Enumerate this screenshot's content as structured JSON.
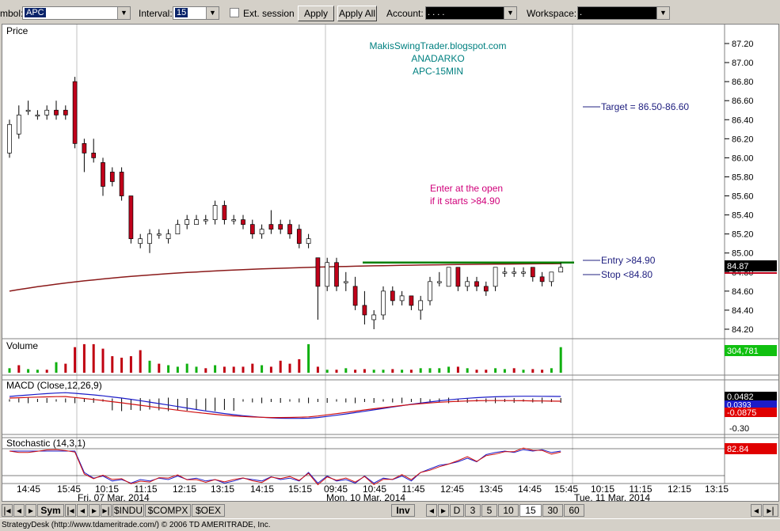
{
  "toolbar": {
    "symbol_label": "mbol:",
    "symbol_value": "APC",
    "interval_label": "Interval:",
    "interval_value": "15",
    "ext_session_label": "Ext. session",
    "apply_label": "Apply",
    "apply_all_label": "Apply All",
    "account_label": "Account:",
    "account_value": ".  .  .  .",
    "workspace_label": "Workspace:",
    "workspace_value": "."
  },
  "chart": {
    "price_panel_title": "Price",
    "watermark_line1": "MakisSwingTrader.blogspot.com",
    "watermark_line2": "ANADARKO",
    "watermark_line3": "APC-15MIN",
    "note_line1": "Enter at the open",
    "note_line2": "if it starts >84.90",
    "target_label": "Target = 86.50-86.60",
    "entry_label": "Entry >84.90",
    "stop_label": "Stop <84.80",
    "current_price_badge": "84.87",
    "price_axis_labels": [
      "87.20",
      "87.00",
      "86.80",
      "86.60",
      "86.40",
      "86.20",
      "86.00",
      "85.80",
      "85.60",
      "85.40",
      "85.20",
      "85.00",
      "84.80",
      "84.60",
      "84.40",
      "84.20"
    ],
    "volume_title": "Volume",
    "volume_badge": "304,781",
    "macd_title": "MACD (Close,12,26,9)",
    "macd_badge_1": "0.0482",
    "macd_badge_2": "0.0393",
    "macd_badge_3": "-0.0875",
    "macd_axis_low": "-0.30",
    "stoch_title": "Stochastic (14,3,1)",
    "stoch_badge": "82.84",
    "time_labels": [
      "14:45",
      "15:45",
      "10:15",
      "11:15",
      "12:15",
      "13:15",
      "14:15",
      "15:15",
      "09:45",
      "10:45",
      "11:45",
      "12:45",
      "13:45",
      "14:45",
      "15:45",
      "10:15",
      "11:15",
      "12:15",
      "13:15"
    ],
    "date_labels": [
      "Fri, 07 Mar, 2014",
      "Mon, 10 Mar, 2014",
      "Tue, 11 Mar, 2014"
    ],
    "colors": {
      "up": "#ffffff",
      "down": "#c0001a",
      "ma": "#8b1a1a",
      "entry_line": "#008000",
      "macd_line": "#1c1cc8",
      "signal_line": "#d01010",
      "watermark": "#008080",
      "note": "#d0007a",
      "label_blue": "#202080"
    }
  },
  "candles": [
    [
      86.05,
      86.35,
      86.0,
      86.4
    ],
    [
      86.25,
      86.45,
      86.2,
      86.55
    ],
    [
      86.5,
      86.5,
      86.45,
      86.6
    ],
    [
      86.45,
      86.45,
      86.4,
      86.5
    ],
    [
      86.45,
      86.5,
      86.4,
      86.55
    ],
    [
      86.5,
      86.45,
      86.4,
      86.6
    ],
    [
      86.5,
      86.45,
      86.4,
      86.55
    ],
    [
      86.8,
      86.15,
      86.1,
      86.85
    ],
    [
      86.15,
      86.05,
      85.85,
      86.2
    ],
    [
      86.05,
      86.0,
      85.95,
      86.2
    ],
    [
      85.95,
      85.7,
      85.6,
      86.0
    ],
    [
      85.85,
      85.75,
      85.7,
      85.9
    ],
    [
      85.85,
      85.6,
      85.55,
      85.9
    ],
    [
      85.6,
      85.15,
      85.1,
      85.6
    ],
    [
      85.1,
      85.15,
      85.05,
      85.2
    ],
    [
      85.1,
      85.2,
      85.0,
      85.25
    ],
    [
      85.2,
      85.2,
      85.15,
      85.25
    ],
    [
      85.15,
      85.2,
      85.1,
      85.25
    ],
    [
      85.2,
      85.3,
      85.2,
      85.35
    ],
    [
      85.3,
      85.35,
      85.25,
      85.4
    ],
    [
      85.3,
      85.35,
      85.3,
      85.4
    ],
    [
      85.35,
      85.35,
      85.3,
      85.4
    ],
    [
      85.35,
      85.5,
      85.3,
      85.55
    ],
    [
      85.5,
      85.35,
      85.3,
      85.55
    ],
    [
      85.35,
      85.35,
      85.3,
      85.4
    ],
    [
      85.35,
      85.3,
      85.25,
      85.4
    ],
    [
      85.3,
      85.2,
      85.15,
      85.35
    ],
    [
      85.2,
      85.25,
      85.15,
      85.3
    ],
    [
      85.3,
      85.25,
      85.2,
      85.45
    ],
    [
      85.3,
      85.25,
      85.2,
      85.35
    ],
    [
      85.3,
      85.2,
      85.15,
      85.35
    ],
    [
      85.25,
      85.1,
      85.05,
      85.3
    ],
    [
      85.1,
      85.15,
      85.05,
      85.2
    ],
    [
      84.95,
      84.65,
      84.3,
      84.95
    ],
    [
      84.65,
      84.9,
      84.6,
      84.95
    ],
    [
      84.9,
      84.65,
      84.6,
      84.95
    ],
    [
      84.7,
      84.7,
      84.6,
      84.8
    ],
    [
      84.65,
      84.45,
      84.4,
      84.75
    ],
    [
      84.45,
      84.35,
      84.25,
      84.6
    ],
    [
      84.3,
      84.35,
      84.2,
      84.4
    ],
    [
      84.35,
      84.6,
      84.3,
      84.65
    ],
    [
      84.6,
      84.5,
      84.45,
      84.65
    ],
    [
      84.5,
      84.55,
      84.45,
      84.6
    ],
    [
      84.55,
      84.45,
      84.4,
      84.55
    ],
    [
      84.4,
      84.5,
      84.3,
      84.55
    ],
    [
      84.5,
      84.7,
      84.45,
      84.75
    ],
    [
      84.7,
      84.7,
      84.65,
      84.8
    ],
    [
      84.65,
      84.85,
      84.65,
      84.85
    ],
    [
      84.85,
      84.65,
      84.6,
      84.85
    ],
    [
      84.65,
      84.7,
      84.6,
      84.75
    ],
    [
      84.7,
      84.65,
      84.6,
      84.75
    ],
    [
      84.65,
      84.6,
      84.55,
      84.7
    ],
    [
      84.65,
      84.85,
      84.6,
      84.85
    ],
    [
      84.8,
      84.8,
      84.75,
      84.85
    ],
    [
      84.8,
      84.8,
      84.75,
      84.85
    ],
    [
      84.8,
      84.8,
      84.75,
      84.85
    ],
    [
      84.85,
      84.75,
      84.7,
      84.85
    ],
    [
      84.75,
      84.7,
      84.65,
      84.8
    ],
    [
      84.7,
      84.8,
      84.65,
      84.8
    ],
    [
      84.8,
      84.85,
      84.8,
      84.9
    ]
  ],
  "volumes": [
    0.15,
    0.25,
    0.12,
    0.1,
    0.1,
    0.35,
    0.3,
    0.85,
    0.95,
    0.95,
    0.8,
    0.55,
    0.5,
    0.55,
    0.75,
    0.4,
    0.3,
    0.25,
    0.2,
    0.3,
    0.2,
    0.15,
    0.25,
    0.2,
    0.2,
    0.2,
    0.3,
    0.25,
    0.2,
    0.4,
    0.3,
    0.45,
    0.95,
    0.2,
    0.1,
    0.1,
    0.15,
    0.1,
    0.12,
    0.1,
    0.1,
    0.12,
    0.1,
    0.1,
    0.15,
    0.15,
    0.15,
    0.2,
    0.2,
    0.15,
    0.1,
    0.1,
    0.15,
    0.12,
    0.15,
    0.1,
    0.12,
    0.1,
    0.15,
    0.85
  ],
  "volume_colors": [
    "g",
    "r",
    "g",
    "g",
    "r",
    "g",
    "r",
    "r",
    "r",
    "r",
    "r",
    "r",
    "r",
    "r",
    "r",
    "g",
    "r",
    "g",
    "g",
    "g",
    "g",
    "r",
    "g",
    "r",
    "r",
    "r",
    "r",
    "g",
    "r",
    "r",
    "r",
    "r",
    "g",
    "r",
    "g",
    "r",
    "g",
    "r",
    "r",
    "g",
    "g",
    "r",
    "g",
    "r",
    "g",
    "g",
    "g",
    "g",
    "r",
    "g",
    "r",
    "r",
    "g",
    "g",
    "r",
    "g",
    "r",
    "r",
    "g",
    "g"
  ]
}
